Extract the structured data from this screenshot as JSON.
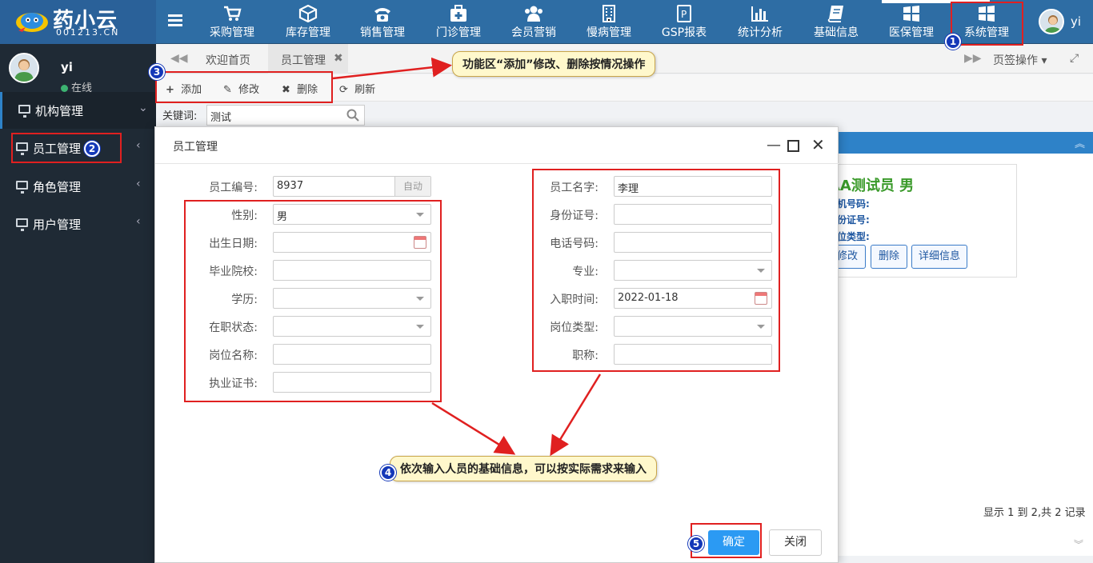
{
  "logo": {
    "name": "药小云",
    "domain": "001213.CN"
  },
  "nav": [
    {
      "label": "采购管理",
      "icon": "cart-icon"
    },
    {
      "label": "库存管理",
      "icon": "box-icon"
    },
    {
      "label": "销售管理",
      "icon": "phone-icon"
    },
    {
      "label": "门诊管理",
      "icon": "medkit-icon"
    },
    {
      "label": "会员营销",
      "icon": "users-icon"
    },
    {
      "label": "慢病管理",
      "icon": "building-icon"
    },
    {
      "label": "GSP报表",
      "icon": "document-icon"
    },
    {
      "label": "统计分析",
      "icon": "bar-chart-icon"
    },
    {
      "label": "基础信息",
      "icon": "book-icon"
    },
    {
      "label": "医保管理",
      "icon": "windows-icon"
    },
    {
      "label": "系统管理",
      "icon": "windows-icon"
    }
  ],
  "user": {
    "name": "yi",
    "status": "在线"
  },
  "sidebar": [
    {
      "label": "机构管理",
      "chevron": "⌄"
    },
    {
      "label": "员工管理",
      "chevron": "‹"
    },
    {
      "label": "角色管理",
      "chevron": "‹"
    },
    {
      "label": "用户管理",
      "chevron": "‹"
    }
  ],
  "tabs": {
    "home": "欢迎首页",
    "active": "员工管理",
    "ops": "页签操作"
  },
  "toolbar": {
    "add": "添加",
    "edit": "修改",
    "delete": "删除",
    "refresh": "刷新"
  },
  "search": {
    "label": "关键词:",
    "value": "测试"
  },
  "background": {
    "person": "AA测试员 男",
    "phone_label": "手机号码:",
    "id_label": "身份证号:",
    "post_label": "岗位类型:",
    "btn_edit": "修改",
    "btn_delete": "删除",
    "btn_detail": "详细信息",
    "pager": "显示 1 到 2,共 2 记录"
  },
  "modal": {
    "title": "员工管理",
    "left": [
      {
        "label": "员工编号:",
        "value": "8937",
        "type": "text",
        "suffix": "自动"
      },
      {
        "label": "性别:",
        "value": "男",
        "type": "select"
      },
      {
        "label": "出生日期:",
        "value": "",
        "type": "date"
      },
      {
        "label": "毕业院校:",
        "value": "",
        "type": "text"
      },
      {
        "label": "学历:",
        "value": "",
        "type": "select"
      },
      {
        "label": "在职状态:",
        "value": "",
        "type": "select"
      },
      {
        "label": "岗位名称:",
        "value": "",
        "type": "text"
      },
      {
        "label": "执业证书:",
        "value": "",
        "type": "text"
      }
    ],
    "right": [
      {
        "label": "员工名字:",
        "value": "李理",
        "type": "text"
      },
      {
        "label": "身份证号:",
        "value": "",
        "type": "text"
      },
      {
        "label": "电话号码:",
        "value": "",
        "type": "text"
      },
      {
        "label": "专业:",
        "value": "",
        "type": "select"
      },
      {
        "label": "入职时间:",
        "value": "2022-01-18",
        "type": "date"
      },
      {
        "label": "岗位类型:",
        "value": "",
        "type": "select"
      },
      {
        "label": "职称:",
        "value": "",
        "type": "text"
      }
    ],
    "confirm": "确定",
    "close": "关闭"
  },
  "annotations": {
    "callout_toolbar": "功能区“添加”修改、删除按情况操作",
    "callout_form": "依次输入人员的基础信息，可以按实际需求来输入",
    "badges": [
      "1",
      "2",
      "3",
      "4",
      "5"
    ]
  },
  "colors": {
    "topbar": "#2e6da4",
    "sidebar": "#1f2a35",
    "accent": "#2196f3",
    "annotation_red": "#e02020",
    "badge_blue": "#1438b8"
  }
}
